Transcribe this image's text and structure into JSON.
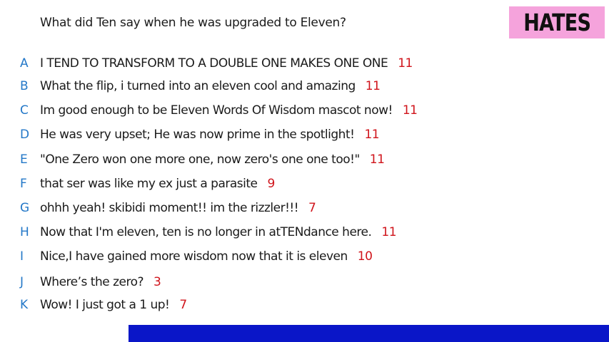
{
  "question": "What did Ten say when he was upgraded to Eleven?",
  "badge": {
    "label": "HATES",
    "color": "#f5a3dc"
  },
  "answers": [
    {
      "letter": "A",
      "text": "I TEND TO TRANSFORM TO A DOUBLE ONE MAKES ONE ONE",
      "count": "11"
    },
    {
      "letter": "B",
      "text": "What the flip, i turned into an eleven cool and amazing",
      "count": "11"
    },
    {
      "letter": "C",
      "text": "Im good enough to be Eleven Words Of Wisdom mascot now!",
      "count": "11"
    },
    {
      "letter": "D",
      "text": "He was very upset; He was now prime in the spotlight!",
      "count": "11"
    },
    {
      "letter": "E",
      "text": "\"One Zero won one more one, now zero's one one too!\"",
      "count": "11"
    },
    {
      "letter": "F",
      "text": "that ser was like my ex just a parasite",
      "count": "9"
    },
    {
      "letter": "G",
      "text": "ohhh yeah! skibidi moment!! im the rizzler!!!",
      "count": "7"
    },
    {
      "letter": "H",
      "text": "Now that I'm eleven, ten is no longer in atTENdance here.",
      "count": "11"
    },
    {
      "letter": "I",
      "text": "Nice,I have gained more wisdom now that it is eleven",
      "count": "10"
    },
    {
      "letter": "J",
      "text": "Where’s the zero?",
      "count": "3"
    },
    {
      "letter": "K",
      "text": "Wow! I just got a 1 up!",
      "count": "7"
    }
  ],
  "colors": {
    "letter": "#2478c8",
    "count": "#d0141b",
    "bottom_bar": "#0a16c8"
  }
}
